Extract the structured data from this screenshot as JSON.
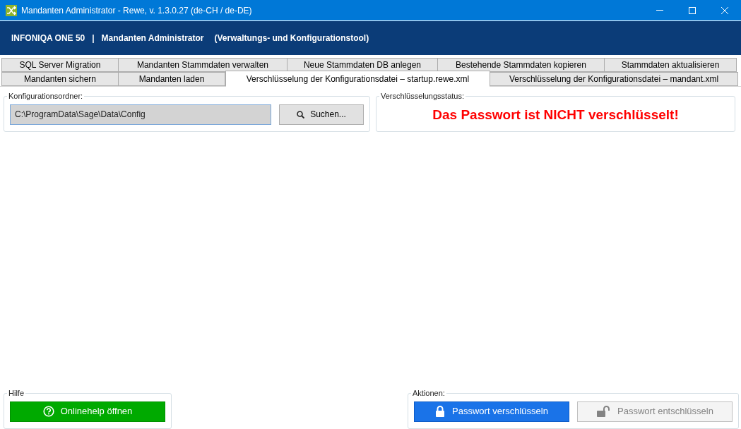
{
  "window": {
    "title": "Mandanten Administrator - Rewe, v. 1.3.0.27 (de-CH / de-DE)"
  },
  "header": {
    "product": "INFONIQA ONE 50",
    "separator": "|",
    "app": "Mandanten Administrator",
    "subtitle": "(Verwaltungs- und Konfigurationstool)"
  },
  "tab_rows": [
    {
      "tabs": [
        {
          "label": "SQL Server Migration",
          "selected": false
        },
        {
          "label": "Mandanten Stammdaten verwalten",
          "selected": false
        },
        {
          "label": "Neue Stammdaten DB anlegen",
          "selected": false
        },
        {
          "label": "Bestehende Stammdaten kopieren",
          "selected": false
        },
        {
          "label": "Stammdaten aktualisieren",
          "selected": false
        }
      ]
    },
    {
      "tabs": [
        {
          "label": "Mandanten sichern",
          "selected": false
        },
        {
          "label": "Mandanten laden",
          "selected": false
        },
        {
          "label": "Verschlüsselung der Konfigurationsdatei – startup.rewe.xml",
          "selected": true
        },
        {
          "label": "Verschlüsselung der Konfigurationsdatei – mandant.xml",
          "selected": false
        }
      ]
    }
  ],
  "config_folder": {
    "legend": "Konfigurationsordner:",
    "value": "C:\\ProgramData\\Sage\\Data\\Config",
    "button": "Suchen..."
  },
  "status": {
    "legend": "Verschlüsselungsstatus:",
    "message": "Das Passwort ist NICHT verschlüsselt!"
  },
  "help": {
    "legend": "Hilfe",
    "button": "Onlinehelp öffnen"
  },
  "actions": {
    "legend": "Aktionen:",
    "buttons": [
      {
        "label": "Passwort verschlüsseln",
        "kind": "lock",
        "disabled": false
      },
      {
        "label": "Passwort entschlüsseln",
        "kind": "unlock",
        "disabled": true
      }
    ]
  }
}
